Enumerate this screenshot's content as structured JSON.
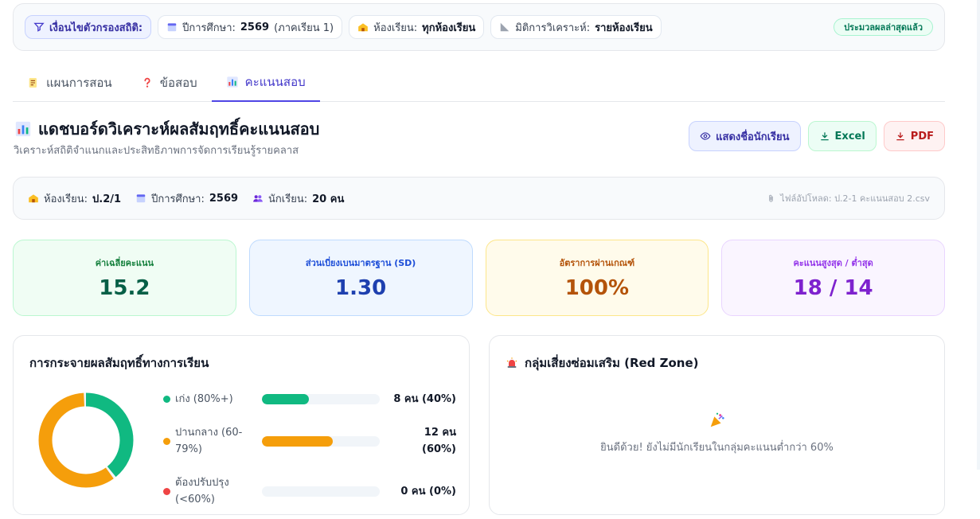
{
  "filter_bar": {
    "filter_label": "เงื่อนไขตัวกรองสถิติ:",
    "year_label": "ปีการศึกษา:",
    "year_value": "2569",
    "year_term": "(ภาคเรียน 1)",
    "room_label": "ห้องเรียน:",
    "room_value": "ทุกห้องเรียน",
    "dimension_label": "มิติการวิเคราะห์:",
    "dimension_value": "รายห้องเรียน",
    "status": "ประมวลผลล่าสุดแล้ว"
  },
  "tabs": [
    {
      "label": "แผนการสอน",
      "icon": "memo-icon",
      "active": false
    },
    {
      "label": "ข้อสอบ",
      "icon": "question-icon",
      "active": false
    },
    {
      "label": "คะแนนสอบ",
      "icon": "bar-chart-icon",
      "active": true
    }
  ],
  "header": {
    "title": "แดชบอร์ดวิเคราะห์ผลสัมฤทธิ์คะแนนสอบ",
    "subtitle": "วิเคราะห์สถิติจำแนกและประสิทธิภาพการจัดการเรียนรู้รายคลาส",
    "show_names_button": "แสดงชื่อนักเรียน",
    "excel_button": "Excel",
    "pdf_button": "PDF"
  },
  "info": {
    "room_label": "ห้องเรียน:",
    "room_value": "ป.2/1",
    "year_label": "ปีการศึกษา:",
    "year_value": "2569",
    "students_label": "นักเรียน:",
    "students_value": "20 คน",
    "file_label": "ไฟล์อัปโหลด: ป.2-1 คะแนนสอบ 2.csv"
  },
  "stats": [
    {
      "label": "ค่าเฉลี่ยคะแนน",
      "value": "15.2",
      "tone": "green"
    },
    {
      "label": "ส่วนเบี่ยงเบนมาตรฐาน (SD)",
      "value": "1.30",
      "tone": "blue"
    },
    {
      "label": "อัตราการผ่านเกณฑ์",
      "value": "100%",
      "tone": "amber"
    },
    {
      "label": "คะแนนสูงสุด / ต่ำสุด",
      "value": "18 / 14",
      "tone": "purple"
    }
  ],
  "distribution": {
    "title": "การกระจายผลสัมฤทธิ์ทางการเรียน",
    "levels": [
      {
        "label": "เก่ง (80%+)",
        "count_text": "8 คน (40%)",
        "percent": 40,
        "color": "#10b981"
      },
      {
        "label": "ปานกลาง (60-79%)",
        "count_text": "12 คน (60%)",
        "percent": 60,
        "color": "#f59e0b"
      },
      {
        "label": "ต้องปรับปรุง (<60%)",
        "count_text": "0 คน (0%)",
        "percent": 0,
        "color": "#ef4444"
      }
    ]
  },
  "risk": {
    "title": "กลุ่มเสี่ยงซ่อมเสริม (Red Zone)",
    "empty_message": "ยินดีด้วย! ยังไม่มีนักเรียนในกลุ่มคะแนนต่ำกว่า 60%"
  }
}
